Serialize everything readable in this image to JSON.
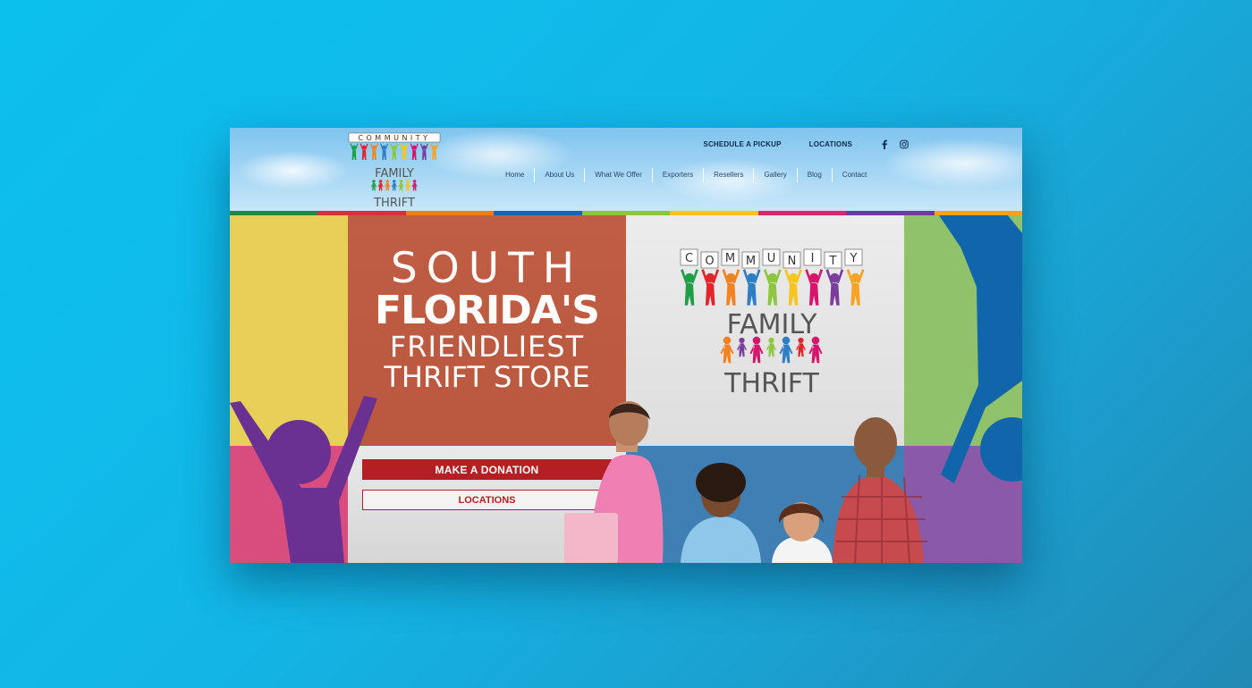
{
  "site": {
    "brand_top": "COMMUNITY",
    "brand_mid": "FAMILY",
    "brand_bottom": "THRIFT"
  },
  "top_bar": {
    "schedule": "SCHEDULE A PICKUP",
    "locations": "LOCATIONS",
    "social": [
      "facebook-icon",
      "instagram-icon"
    ]
  },
  "nav": {
    "items": [
      "Home",
      "About Us",
      "What We Offer",
      "Exporters",
      "Resellers",
      "Gallery",
      "Blog",
      "Contact"
    ]
  },
  "hero": {
    "line1": "SOUTH",
    "line2": "FLORIDA'S",
    "line3": "FRIENDLIEST",
    "line4": "THRIFT STORE",
    "donate_button": "MAKE A DONATION",
    "locations_button": "LOCATIONS"
  },
  "colors": {
    "stripe": [
      "#1e8a3c",
      "#d93030",
      "#f07b1f",
      "#1766b4",
      "#8cc63f",
      "#f3c623",
      "#d4276f",
      "#6c3b9c",
      "#f4a21d"
    ],
    "figures": [
      "#1f9e48",
      "#e0262b",
      "#f58220",
      "#2f7dc2",
      "#8dc63f",
      "#f8c51c",
      "#d7156d",
      "#7a3e9d",
      "#f7a325"
    ],
    "accent_red": "#b31f23"
  }
}
